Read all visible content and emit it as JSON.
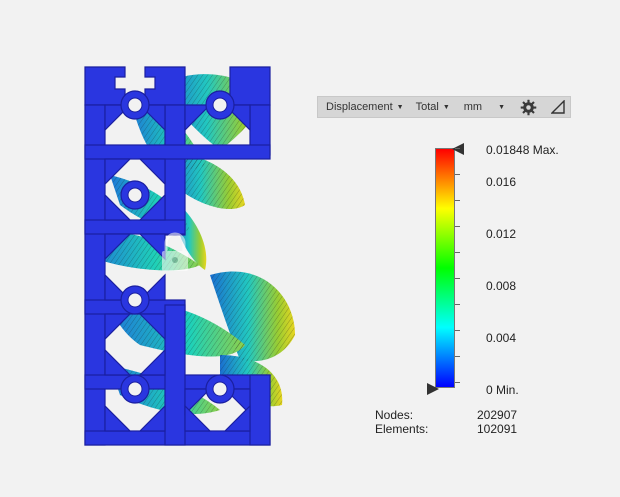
{
  "toolbar": {
    "result_type": "Displacement",
    "component": "Total",
    "unit": "mm",
    "settings_icon": "gear-icon",
    "expand_icon": "expand-triangle-icon"
  },
  "legend": {
    "max_label": "0.01848 Max.",
    "min_label": "0 Min.",
    "ticks": [
      "0.016",
      "0.012",
      "0.008",
      "0.004"
    ],
    "colors": [
      "#ff0000",
      "#ffff00",
      "#00ff00",
      "#00ffff",
      "#0000ff"
    ]
  },
  "stats": {
    "nodes_label": "Nodes:",
    "nodes_value": "202907",
    "elements_label": "Elements:",
    "elements_value": "102091"
  },
  "model": {
    "base_color": "#2233dd",
    "lock_icon": "lock-icon"
  }
}
